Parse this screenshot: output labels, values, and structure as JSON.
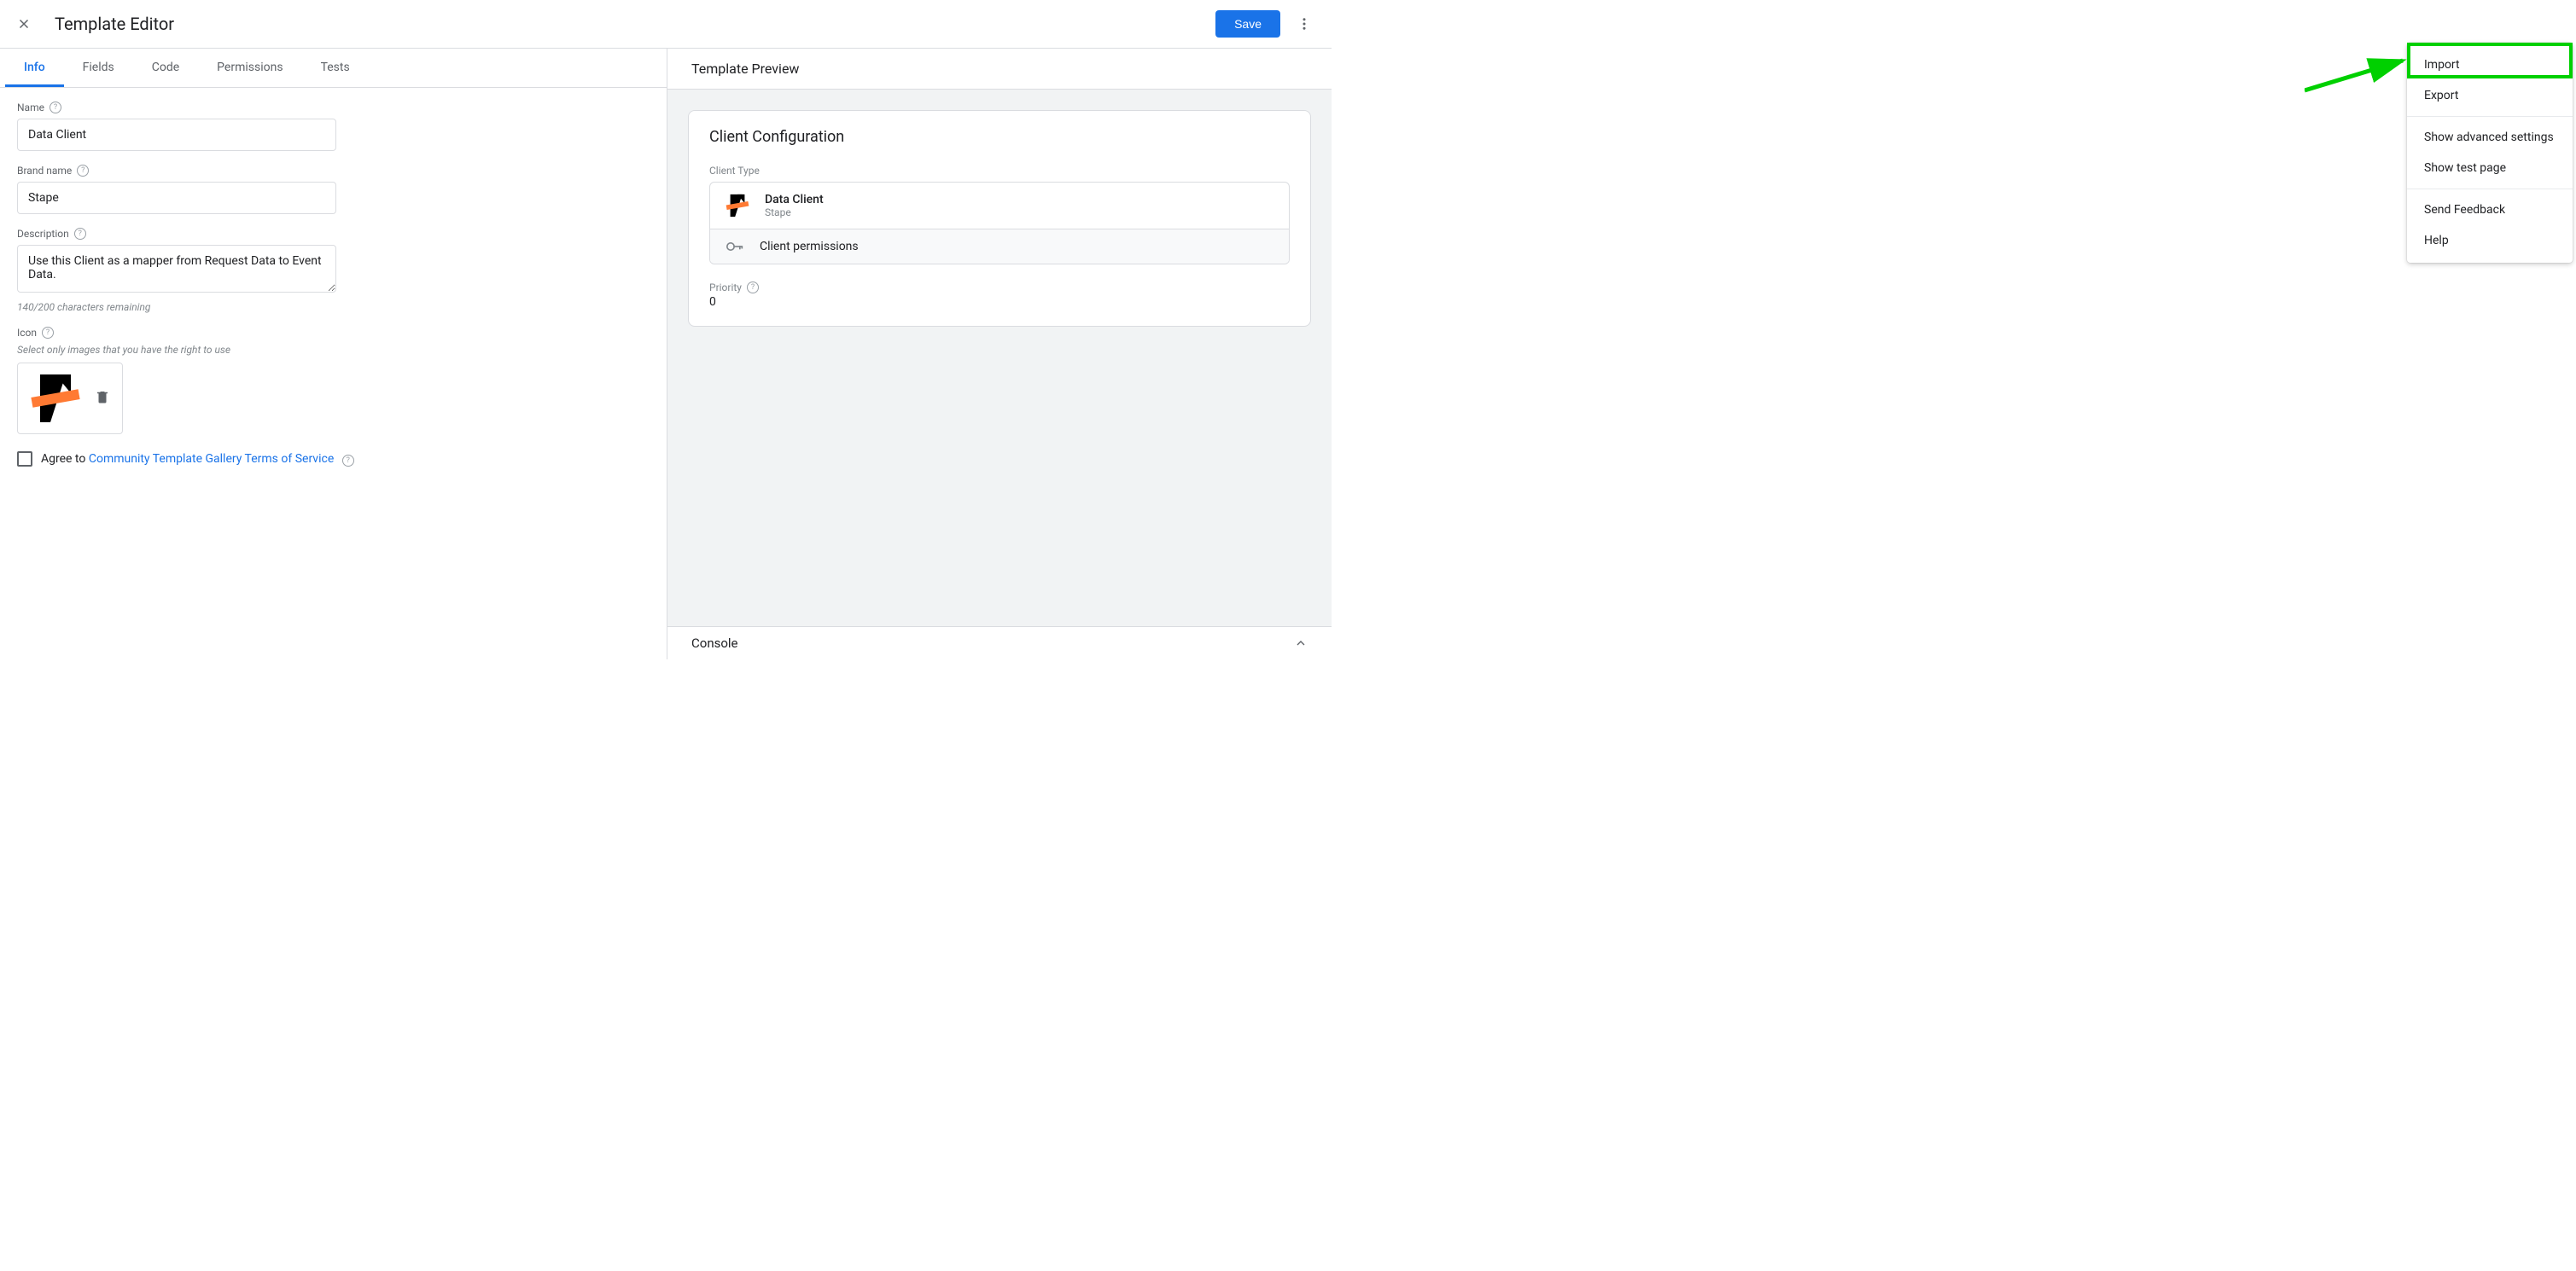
{
  "header": {
    "title": "Template Editor",
    "save_label": "Save"
  },
  "tabs": {
    "info": "Info",
    "fields": "Fields",
    "code": "Code",
    "permissions": "Permissions",
    "tests": "Tests"
  },
  "form": {
    "name_label": "Name",
    "name_value": "Data Client",
    "brand_label": "Brand name",
    "brand_value": "Stape",
    "desc_label": "Description",
    "desc_value": "Use this Client as a mapper from Request Data to Event Data.",
    "desc_helper": "140/200 characters remaining",
    "icon_label": "Icon",
    "icon_helper": "Select only images that you have the right to use",
    "agree_prefix": "Agree to ",
    "agree_link": "Community Template Gallery Terms of Service"
  },
  "preview": {
    "header": "Template Preview",
    "card_title": "Client Configuration",
    "client_type_label": "Client Type",
    "client_name": "Data Client",
    "client_brand": "Stape",
    "permissions_label": "Client permissions",
    "priority_label": "Priority",
    "priority_value": "0",
    "console_label": "Console"
  },
  "menu": {
    "import": "Import",
    "export": "Export",
    "advanced": "Show advanced settings",
    "testpage": "Show test page",
    "feedback": "Send Feedback",
    "help": "Help"
  }
}
